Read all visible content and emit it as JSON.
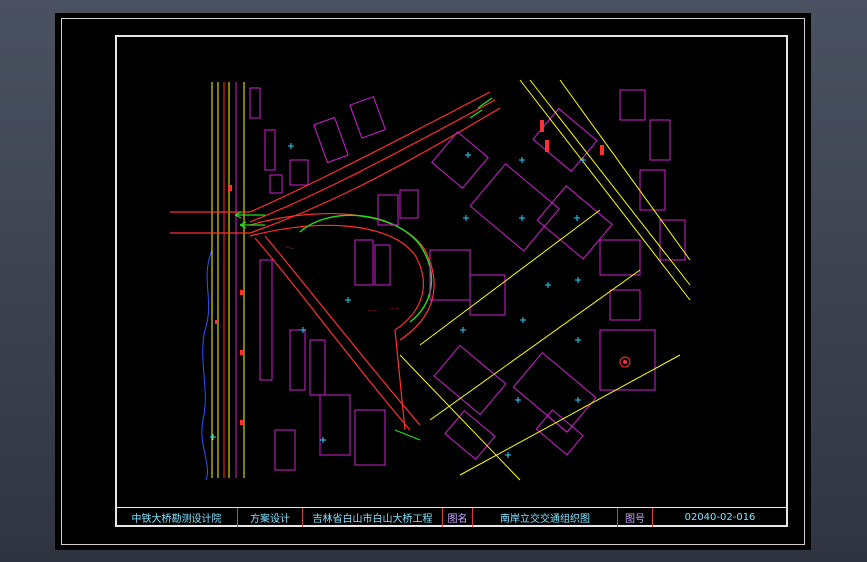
{
  "title_block": {
    "company": "中铁大桥勘测设计院",
    "stage": "方案设计",
    "project": "吉林省白山市白山大桥工程",
    "drawing_name_label": "图名",
    "drawing_name": "南岸立交交通组织图",
    "drawing_no_label": "图号",
    "drawing_no": "02040-02-016"
  },
  "colors": {
    "background": "#000000",
    "road_lines": "#ff3030",
    "buildings": "#d020d0",
    "traffic_arrows": "#20e020",
    "road_edges": "#ffff00",
    "markers": "#30d0ff"
  }
}
